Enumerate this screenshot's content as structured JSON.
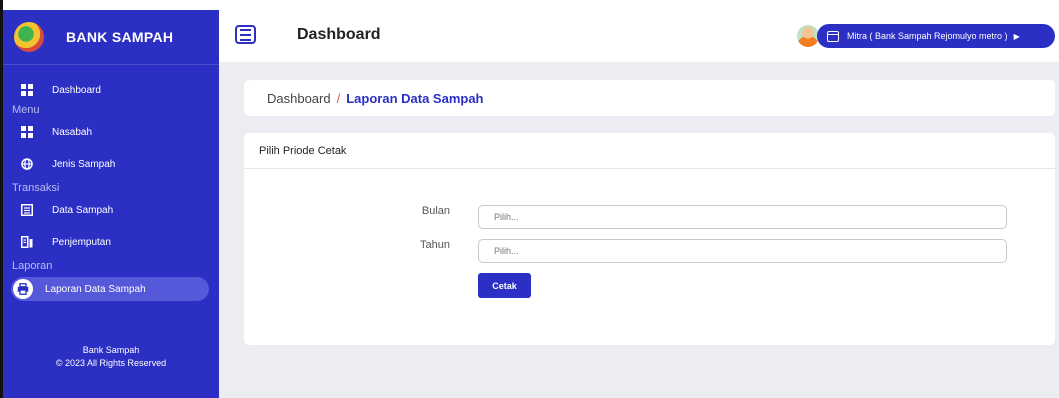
{
  "brand": {
    "name": "BANK SAMPAH"
  },
  "sidebar": {
    "items": [
      {
        "label": "Dashboard",
        "icon": "dashboard-icon"
      },
      {
        "section": "Menu"
      },
      {
        "label": "Nasabah",
        "icon": "users-icon"
      },
      {
        "label": "Jenis Sampah",
        "icon": "globe-icon"
      },
      {
        "section": "Transaksi"
      },
      {
        "label": "Data Sampah",
        "icon": "list-icon"
      },
      {
        "label": "Penjemputan",
        "icon": "truck-icon"
      },
      {
        "section": "Laporan"
      },
      {
        "label": "Laporan Data Sampah",
        "icon": "printer-icon",
        "active": true
      }
    ],
    "footer_line1": "Bank Sampah",
    "footer_line2": "© 2023 All Rights Reserved"
  },
  "header": {
    "title": "Dashboard",
    "user_label": "Mitra ( Bank Sampah Rejomulyo metro )"
  },
  "breadcrumb": {
    "home": "Dashboard",
    "separator": "/",
    "current": "Laporan Data Sampah"
  },
  "form": {
    "header": "Pilih Priode Cetak",
    "bulan_label": "Bulan",
    "bulan_placeholder": "Pilih...",
    "tahun_label": "Tahun",
    "tahun_placeholder": "Pilih...",
    "submit_label": "Cetak"
  },
  "colors": {
    "accent": "#2b2fc4",
    "sidebar_active": "#5558d9",
    "background": "#ececf3"
  }
}
